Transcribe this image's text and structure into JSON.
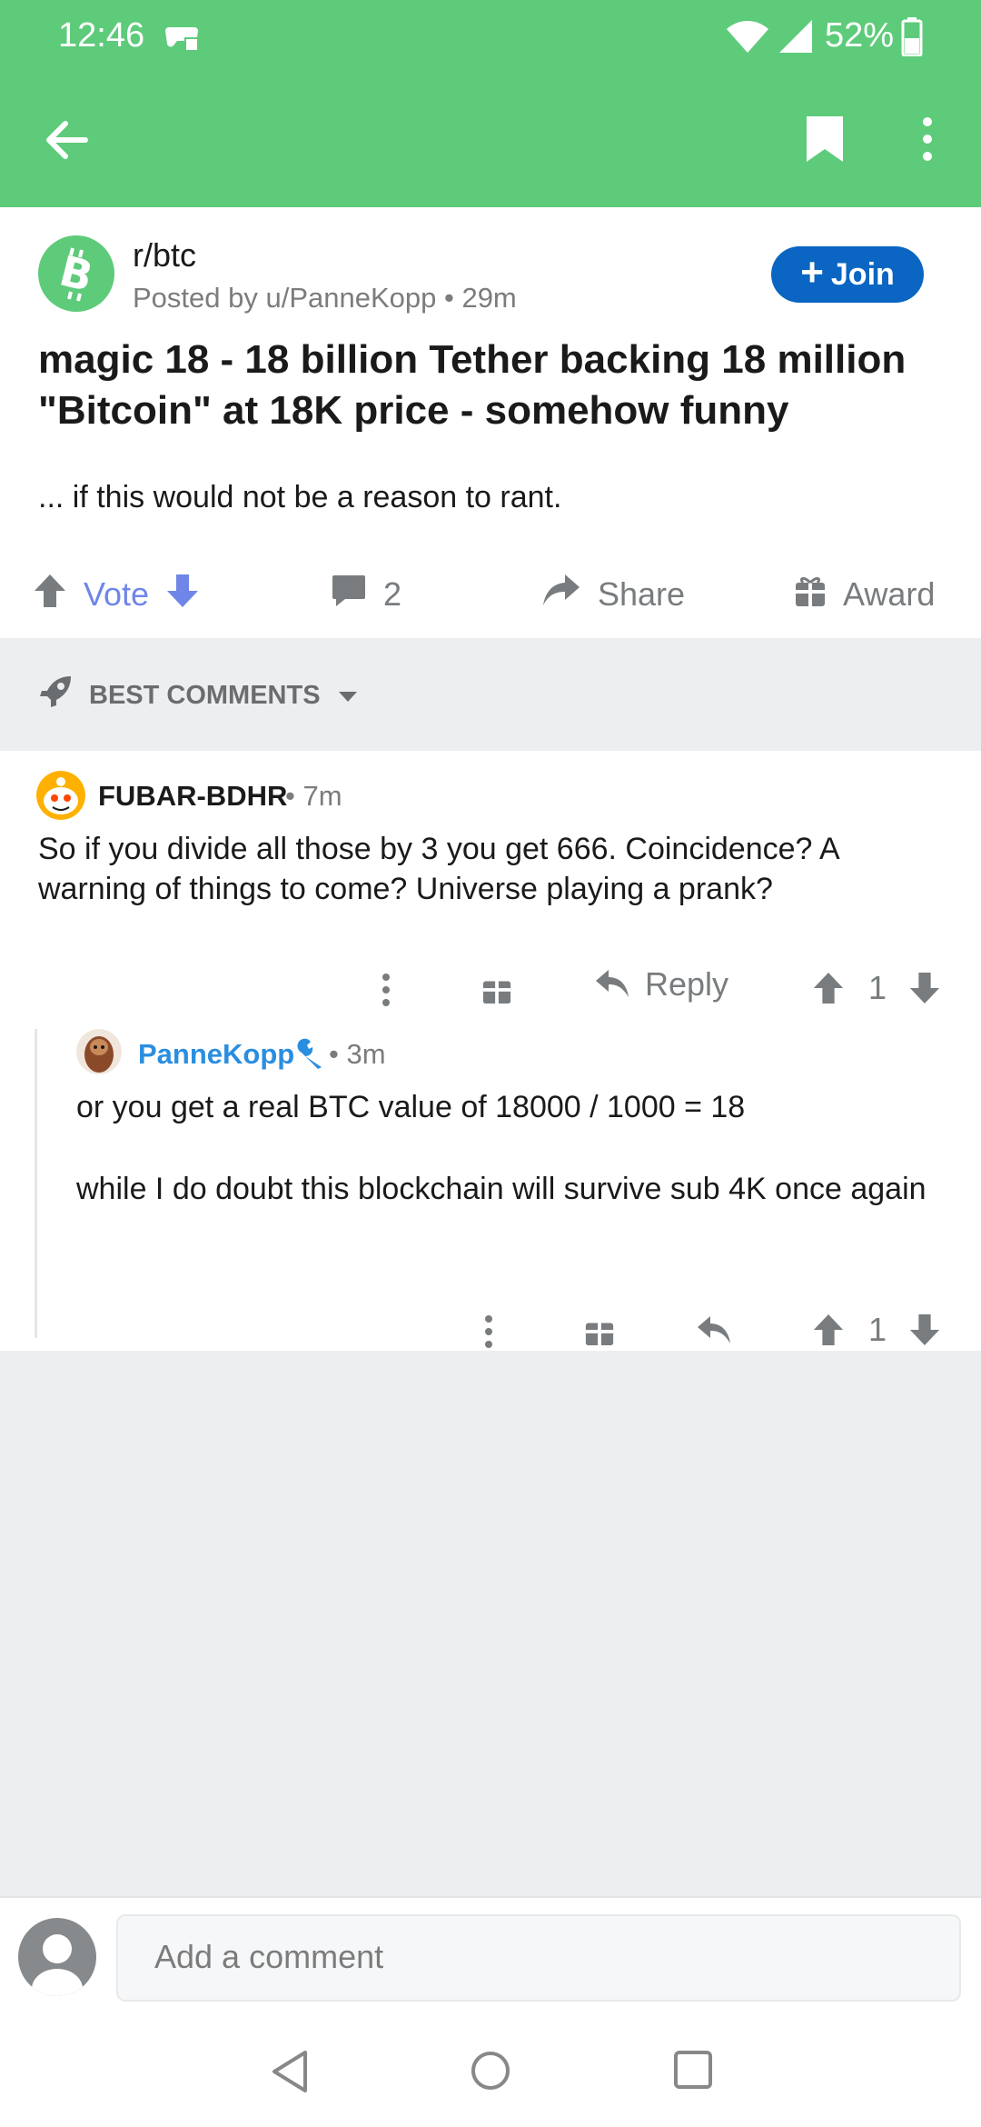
{
  "status_bar": {
    "time": "12:46",
    "battery": "52%"
  },
  "post": {
    "subreddit": "r/btc",
    "posted_by": "Posted by u/PanneKopp • 29m",
    "join_label": "Join",
    "title": "magic 18 - 18 billion Tether backing 18 million \"Bitcoin\" at 18K price - somehow funny",
    "body": "... if this would not be a reason to rant.",
    "vote_label": "Vote",
    "comment_count": "2",
    "share_label": "Share",
    "award_label": "Award"
  },
  "sort": {
    "label": "BEST COMMENTS"
  },
  "comments": [
    {
      "author": "FUBAR-BDHR",
      "time": "• 7m",
      "body": "So if you divide all those by 3 you get 666. Coincidence? A warning of things to come? Universe playing a prank?",
      "reply_label": "Reply",
      "score": "1"
    },
    {
      "author": "PanneKopp",
      "time": "• 3m",
      "body_line1": "or you get a real BTC value of 18000 / 1000 = 18",
      "body_line2": "while I do doubt this blockchain will survive sub 4K once again",
      "score": "1"
    }
  ],
  "composer": {
    "placeholder": "Add a comment"
  },
  "colors": {
    "brand_green": "#5ecb7b",
    "join_blue": "#0a66c2",
    "vote_blue": "#6f86e8",
    "op_blue": "#2a8ee0"
  }
}
